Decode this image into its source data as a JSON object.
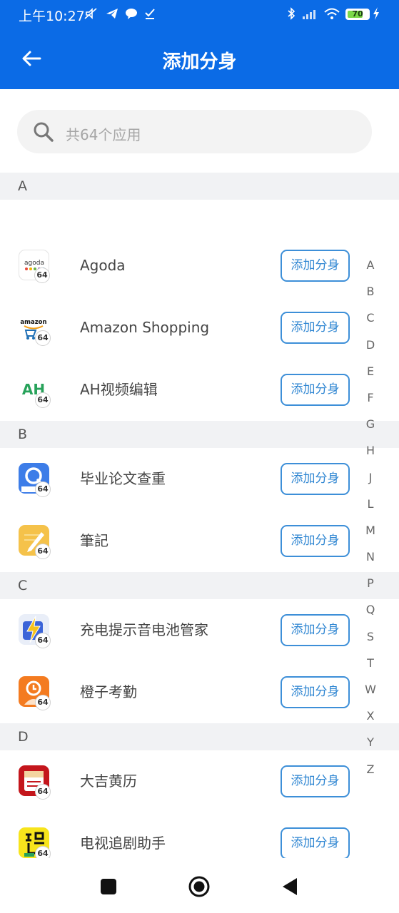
{
  "status_bar": {
    "time": "上午10:27",
    "battery": "70",
    "battery_level": 0.7
  },
  "app_bar": {
    "title": "添加分身",
    "back_icon": "arrow-left"
  },
  "search": {
    "placeholder": "共64个应用",
    "icon": "search"
  },
  "badge_text": "64",
  "add_button_label": "添加分身",
  "sections": [
    {
      "letter": "A",
      "apps": [
        {
          "name": "Agoda",
          "icon": "agoda-icon"
        },
        {
          "name": "Amazon Shopping",
          "icon": "amazon-icon"
        },
        {
          "name": "AH视频编辑",
          "icon": "ah-video-icon"
        }
      ]
    },
    {
      "letter": "B",
      "apps": [
        {
          "name": "毕业论文查重",
          "icon": "thesis-check-icon"
        },
        {
          "name": "筆記",
          "icon": "notes-icon"
        }
      ]
    },
    {
      "letter": "C",
      "apps": [
        {
          "name": "充电提示音电池管家",
          "icon": "charging-icon"
        },
        {
          "name": "橙子考勤",
          "icon": "attendance-icon"
        }
      ]
    },
    {
      "letter": "D",
      "apps": [
        {
          "name": "大吉黄历",
          "icon": "calendar-icon"
        },
        {
          "name": "电视追剧助手",
          "icon": "tv-drama-icon"
        }
      ]
    }
  ],
  "alphabet_index": [
    "A",
    "B",
    "C",
    "D",
    "E",
    "F",
    "G",
    "H",
    "J",
    "L",
    "M",
    "N",
    "P",
    "Q",
    "S",
    "T",
    "W",
    "X",
    "Y",
    "Z"
  ],
  "colors": {
    "primary": "#0b6be6",
    "button_border": "#3d8fd8",
    "section_bg": "#f1f2f4"
  }
}
